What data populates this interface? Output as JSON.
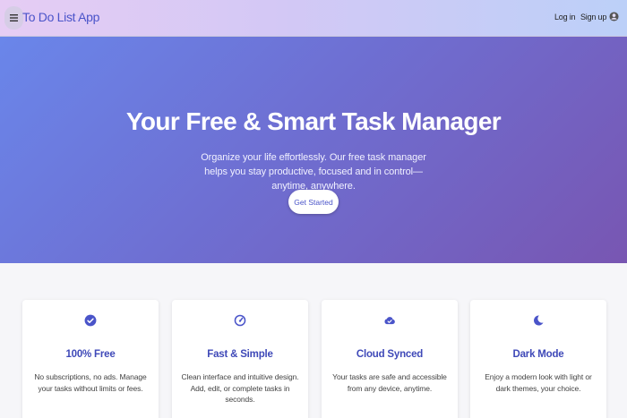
{
  "header": {
    "brand": "To Do List App",
    "menu_icon": "hamburger-menu-icon",
    "login_label": "Log in",
    "signup_label": "Sign up",
    "account_icon": "account-circle-icon"
  },
  "hero": {
    "title": "Your Free & Smart Task Manager",
    "description": "Organize your life effortlessly. Our free task manager helps you stay productive, focused and in control—anytime, anywhere.",
    "cta_label": "Get Started"
  },
  "features": [
    {
      "icon": "check-circle-icon",
      "title": "100% Free",
      "description": "No subscriptions, no ads. Manage your tasks without limits or fees."
    },
    {
      "icon": "speed-gauge-icon",
      "title": "Fast & Simple",
      "description": "Clean interface and intuitive design. Add, edit, or complete tasks in seconds."
    },
    {
      "icon": "cloud-check-icon",
      "title": "Cloud Synced",
      "description": "Your tasks are safe and accessible from any device, anytime."
    },
    {
      "icon": "moon-icon",
      "title": "Dark Mode",
      "description": "Enjoy a modern look with light or dark themes, your choice."
    }
  ],
  "colors": {
    "accent": "#4a54c9",
    "hero_start": "#6a86ea",
    "hero_end": "#7856b2"
  }
}
